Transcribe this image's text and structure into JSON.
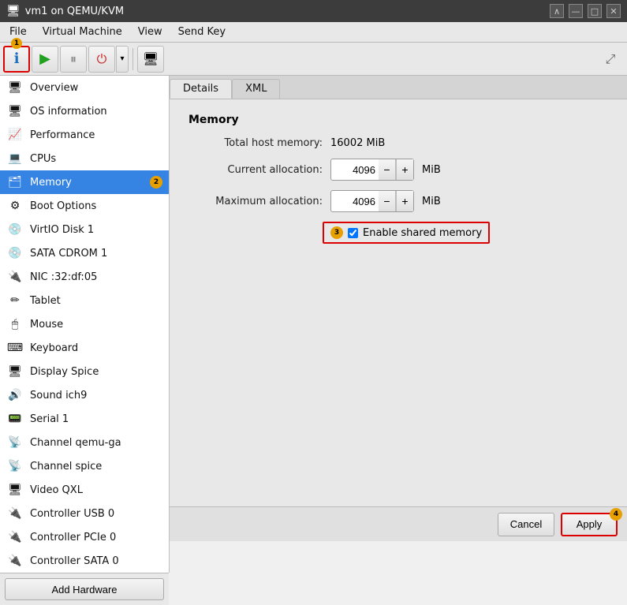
{
  "window": {
    "title": "vm1 on QEMU/KVM",
    "titlebar_icon": "🖥"
  },
  "titlebar_controls": {
    "collapse": "∧",
    "minimize": "—",
    "maximize": "□",
    "close": "✕"
  },
  "menubar": {
    "items": [
      "File",
      "Virtual Machine",
      "View",
      "Send Key"
    ]
  },
  "toolbar": {
    "info_badge": "1",
    "screen_icon": "🖥"
  },
  "sidebar": {
    "items": [
      {
        "id": "overview",
        "label": "Overview",
        "icon": "🖥"
      },
      {
        "id": "os-information",
        "label": "OS information",
        "icon": "🖥"
      },
      {
        "id": "performance",
        "label": "Performance",
        "icon": "📈"
      },
      {
        "id": "cpus",
        "label": "CPUs",
        "icon": "💻"
      },
      {
        "id": "memory",
        "label": "Memory",
        "icon": "🗂",
        "active": true,
        "badge": "2"
      },
      {
        "id": "boot-options",
        "label": "Boot Options",
        "icon": "⚙"
      },
      {
        "id": "virtio-disk-1",
        "label": "VirtIO Disk 1",
        "icon": "💿"
      },
      {
        "id": "sata-cdrom-1",
        "label": "SATA CDROM 1",
        "icon": "💿"
      },
      {
        "id": "nic",
        "label": "NIC :32:df:05",
        "icon": "🔌"
      },
      {
        "id": "tablet",
        "label": "Tablet",
        "icon": "✏"
      },
      {
        "id": "mouse",
        "label": "Mouse",
        "icon": "🖱"
      },
      {
        "id": "keyboard",
        "label": "Keyboard",
        "icon": "⌨"
      },
      {
        "id": "display-spice",
        "label": "Display Spice",
        "icon": "🖥"
      },
      {
        "id": "sound-ich9",
        "label": "Sound ich9",
        "icon": "🔊"
      },
      {
        "id": "serial-1",
        "label": "Serial 1",
        "icon": "📟"
      },
      {
        "id": "channel-qemu-ga",
        "label": "Channel qemu-ga",
        "icon": "📡"
      },
      {
        "id": "channel-spice",
        "label": "Channel spice",
        "icon": "📡"
      },
      {
        "id": "video-qxl",
        "label": "Video QXL",
        "icon": "🖥"
      },
      {
        "id": "controller-usb-0",
        "label": "Controller USB 0",
        "icon": "🔌"
      },
      {
        "id": "controller-pcie-0",
        "label": "Controller PCIe 0",
        "icon": "🔌"
      },
      {
        "id": "controller-sata-0",
        "label": "Controller SATA 0",
        "icon": "🔌"
      }
    ],
    "add_hardware_label": "Add Hardware"
  },
  "panel": {
    "tabs": [
      {
        "id": "details",
        "label": "Details",
        "active": true
      },
      {
        "id": "xml",
        "label": "XML",
        "active": false
      }
    ],
    "memory": {
      "section_title": "Memory",
      "total_host_label": "Total host memory:",
      "total_host_value": "16002 MiB",
      "current_alloc_label": "Current allocation:",
      "current_alloc_value": "4096",
      "current_alloc_unit": "MiB",
      "max_alloc_label": "Maximum allocation:",
      "max_alloc_value": "4096",
      "max_alloc_unit": "MiB",
      "shared_memory_label": "Enable shared memory",
      "shared_memory_checked": true,
      "shared_memory_badge": "3"
    }
  },
  "bottom_bar": {
    "cancel_label": "Cancel",
    "apply_label": "Apply",
    "apply_badge": "4"
  }
}
